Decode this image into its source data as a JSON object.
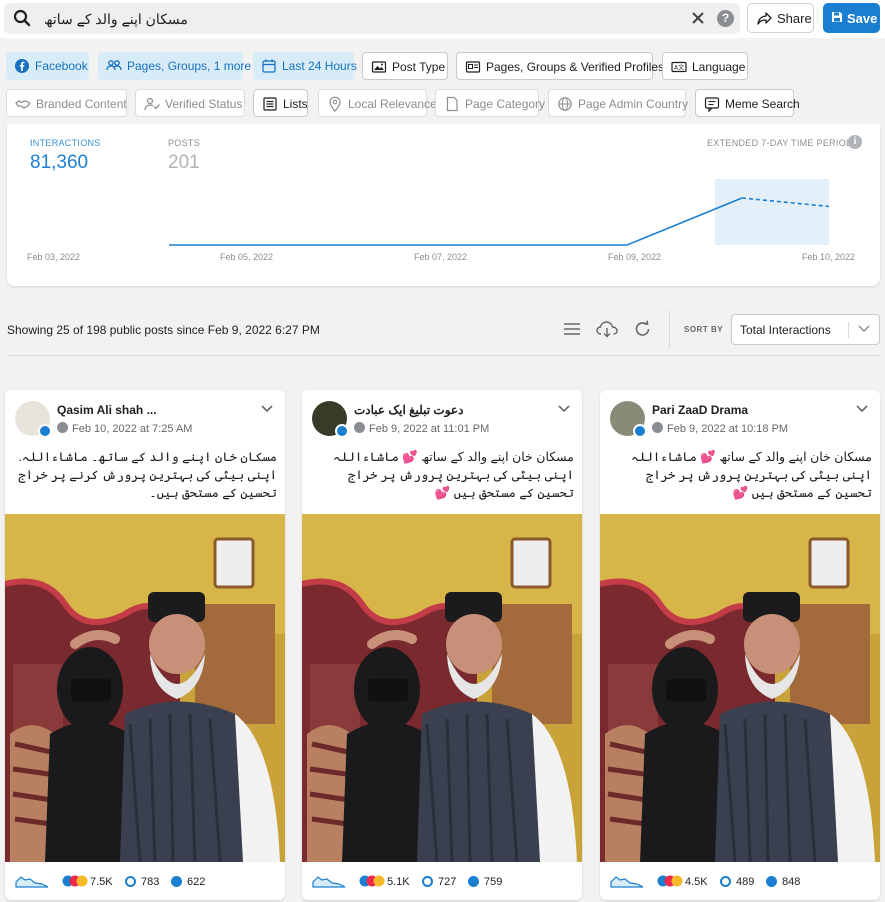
{
  "search": {
    "query": "مسکان اپنے والد کے ساتھ"
  },
  "toolbar": {
    "share_label": "Share",
    "save_label": "Save"
  },
  "filters": {
    "facebook": "Facebook",
    "pages_groups": "Pages, Groups, 1 more",
    "time": "Last 24 Hours",
    "post_type": "Post Type",
    "verified_profiles": "Pages, Groups & Verified Profiles",
    "language": "Language",
    "branded": "Branded Content",
    "verified_status": "Verified Status",
    "lists": "Lists",
    "local_relevance": "Local Relevance",
    "page_category": "Page Category",
    "admin_country": "Page Admin Country",
    "meme_search": "Meme Search"
  },
  "stats": {
    "interactions_label": "INTERACTIONS",
    "interactions_value": "81,360",
    "posts_label": "POSTS",
    "posts_value": "201",
    "extended_label": "EXTENDED 7-DAY TIME PERIOD"
  },
  "chart_data": {
    "type": "line",
    "x_ticks": [
      "Feb 03, 2022",
      "Feb 05, 2022",
      "Feb 07, 2022",
      "Feb 09, 2022",
      "Feb 10, 2022"
    ],
    "series": [
      {
        "values": [
          {
            "x": "Feb 05, 2022",
            "y": 0
          },
          {
            "x": "Feb 09, 2022",
            "y": 0
          },
          {
            "x": "Feb 10, 2022 (midday)",
            "y": 1.0
          },
          {
            "x": "Feb 10, 2022",
            "y": 0.82
          }
        ]
      }
    ],
    "extended_period_highlight": "last day",
    "line_color": "#1b7fd1",
    "highlight_color": "#e3f0fa"
  },
  "results": {
    "showing_text": "Showing 25 of 198 public posts since Feb 9, 2022 6:27 PM",
    "sort_label": "SORT BY",
    "sort_value": "Total Interactions"
  },
  "posts": [
    {
      "name": "Qasim Ali shah ...",
      "date": "Feb 10, 2022 at 7:25 AM",
      "text": "مسکان خان اپنے والد کے ساتھ۔ ماشاءاللہ. اپنی بیٹی کی بہترین پرورش کرنے پر خراج تحسین کے مستحق ہیں۔",
      "reactions": "7.5K",
      "comments": "783",
      "shares": "622"
    },
    {
      "name": "دعوت تبلیغ ایک عبادت",
      "date": "Feb 9, 2022 at 11:01 PM",
      "text": "مسکان خان اپنے والد کے ساتھ 💕 ماشاءاللہ اپنی بیٹی کی بہترین پرورش پر خراج تحسین کے مستحق ہیں 💕",
      "reactions": "5.1K",
      "comments": "727",
      "shares": "759"
    },
    {
      "name": "Pari ZaaD Drama",
      "date": "Feb 9, 2022 at 10:18 PM",
      "text": "مسکان خان اپنے والد کے ساتھ 💕 ماشاءاللہ اپنی بیٹی کی بہترین پرورش پر خراج تحسین کے مستحق ہیں 💕",
      "reactions": "4.5K",
      "comments": "489",
      "shares": "848"
    }
  ]
}
